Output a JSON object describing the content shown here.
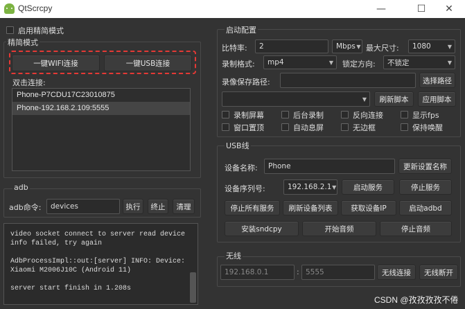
{
  "window": {
    "title": "QtScrcpy",
    "min": "—",
    "max": "☐",
    "close": "✕"
  },
  "simple_mode": {
    "checkbox_label": "启用精简模式",
    "group_title": "精简模式",
    "wifi_button": "一键WIFI连接",
    "usb_button": "一键USB连接"
  },
  "devices": {
    "label": "双击连接:",
    "items": [
      "Phone-P7CDU17C23010875",
      "Phone-192.168.2.109:5555"
    ]
  },
  "adb": {
    "group_title": "adb",
    "cmd_label": "adb命令:",
    "cmd_value": "devices",
    "exec": "执行",
    "stop": "终止",
    "clear": "清理"
  },
  "log": {
    "lines": "video socket connect to server read device\ninfo failed, try again\n\nAdbProcessImpl::out:[server] INFO: Device:\nXiaomi M2006J10C (Android 11)\n\nserver start finish in 1.208s"
  },
  "start_config": {
    "group_title": "启动配置",
    "bitrate_label": "比特率:",
    "bitrate_value": "2",
    "bitrate_unit": "Mbps",
    "maxsize_label": "最大尺寸:",
    "maxsize_value": "1080",
    "record_format_label": "录制格式:",
    "record_format_value": "mp4",
    "lock_orientation_label": "锁定方向:",
    "lock_orientation_value": "不锁定",
    "record_path_label": "录像保存路径:",
    "select_path": "选择路径",
    "script_value": "",
    "refresh_script": "刷新脚本",
    "apply_script": "应用脚本",
    "options": [
      "录制屏幕",
      "后台录制",
      "反向连接",
      "显示fps",
      "窗口置顶",
      "自动息屏",
      "无边框",
      "保持唤醒"
    ]
  },
  "usb": {
    "group_title": "USB线",
    "device_name_label": "设备名称:",
    "device_name_value": "Phone",
    "update_name": "更新设置名称",
    "serial_label": "设备序列号:",
    "serial_value": "192.168.2.1",
    "start_service": "启动服务",
    "stop_service": "停止服务",
    "stop_all": "停止所有服务",
    "refresh_devices": "刷新设备列表",
    "get_ip": "获取设备IP",
    "start_adbd": "启动adbd",
    "install_sndcpy": "安装sndcpy",
    "start_audio": "开始音频",
    "stop_audio": "停止音频"
  },
  "wireless": {
    "group_title": "无线",
    "ip_placeholder": "192.168.0.1",
    "port_placeholder": "5555",
    "connect": "无线连接",
    "disconnect": "无线断开"
  },
  "watermark": "CSDN @孜孜孜孜不倦"
}
